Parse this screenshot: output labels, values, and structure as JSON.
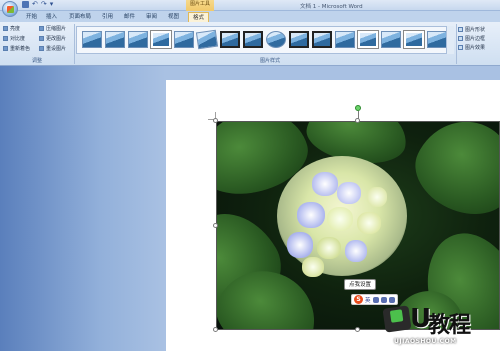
{
  "titlebar": {
    "app_title": "文档 1 - Microsoft Word",
    "contextual_group": "图片工具"
  },
  "tabs": [
    {
      "label": "开始"
    },
    {
      "label": "插入"
    },
    {
      "label": "页面布局"
    },
    {
      "label": "引用"
    },
    {
      "label": "邮件"
    },
    {
      "label": "审阅"
    },
    {
      "label": "视图"
    },
    {
      "label": "格式",
      "active": true
    }
  ],
  "ribbon": {
    "adjust": {
      "label": "调整",
      "items": [
        "亮度",
        "对比度",
        "重新着色",
        "压缩图片",
        "更改图片",
        "重设图片"
      ]
    },
    "styles": {
      "label": "图片样式"
    },
    "effects": {
      "items": [
        "图片形状",
        "图片边框",
        "图片效果"
      ]
    }
  },
  "document": {
    "tooltip": "点我设置",
    "ime": {
      "logo": "S",
      "lang": "英"
    }
  },
  "watermark": {
    "letter": "U",
    "brand": "教程",
    "url": "UJIAOSHOU.COM"
  }
}
